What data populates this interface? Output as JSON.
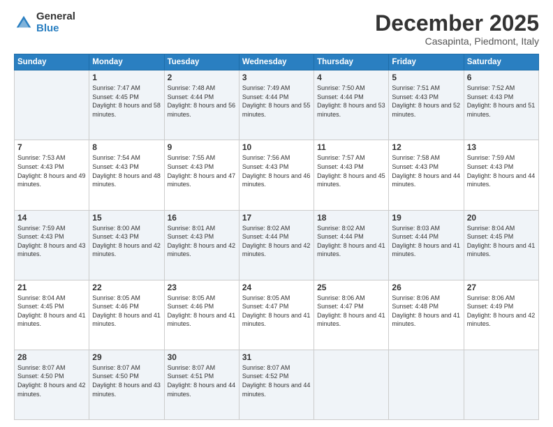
{
  "logo": {
    "general": "General",
    "blue": "Blue"
  },
  "header": {
    "month": "December 2025",
    "location": "Casapinta, Piedmont, Italy"
  },
  "weekdays": [
    "Sunday",
    "Monday",
    "Tuesday",
    "Wednesday",
    "Thursday",
    "Friday",
    "Saturday"
  ],
  "weeks": [
    [
      {
        "day": "",
        "sunrise": "",
        "sunset": "",
        "daylight": ""
      },
      {
        "day": "1",
        "sunrise": "Sunrise: 7:47 AM",
        "sunset": "Sunset: 4:45 PM",
        "daylight": "Daylight: 8 hours and 58 minutes."
      },
      {
        "day": "2",
        "sunrise": "Sunrise: 7:48 AM",
        "sunset": "Sunset: 4:44 PM",
        "daylight": "Daylight: 8 hours and 56 minutes."
      },
      {
        "day": "3",
        "sunrise": "Sunrise: 7:49 AM",
        "sunset": "Sunset: 4:44 PM",
        "daylight": "Daylight: 8 hours and 55 minutes."
      },
      {
        "day": "4",
        "sunrise": "Sunrise: 7:50 AM",
        "sunset": "Sunset: 4:44 PM",
        "daylight": "Daylight: 8 hours and 53 minutes."
      },
      {
        "day": "5",
        "sunrise": "Sunrise: 7:51 AM",
        "sunset": "Sunset: 4:43 PM",
        "daylight": "Daylight: 8 hours and 52 minutes."
      },
      {
        "day": "6",
        "sunrise": "Sunrise: 7:52 AM",
        "sunset": "Sunset: 4:43 PM",
        "daylight": "Daylight: 8 hours and 51 minutes."
      }
    ],
    [
      {
        "day": "7",
        "sunrise": "Sunrise: 7:53 AM",
        "sunset": "Sunset: 4:43 PM",
        "daylight": "Daylight: 8 hours and 49 minutes."
      },
      {
        "day": "8",
        "sunrise": "Sunrise: 7:54 AM",
        "sunset": "Sunset: 4:43 PM",
        "daylight": "Daylight: 8 hours and 48 minutes."
      },
      {
        "day": "9",
        "sunrise": "Sunrise: 7:55 AM",
        "sunset": "Sunset: 4:43 PM",
        "daylight": "Daylight: 8 hours and 47 minutes."
      },
      {
        "day": "10",
        "sunrise": "Sunrise: 7:56 AM",
        "sunset": "Sunset: 4:43 PM",
        "daylight": "Daylight: 8 hours and 46 minutes."
      },
      {
        "day": "11",
        "sunrise": "Sunrise: 7:57 AM",
        "sunset": "Sunset: 4:43 PM",
        "daylight": "Daylight: 8 hours and 45 minutes."
      },
      {
        "day": "12",
        "sunrise": "Sunrise: 7:58 AM",
        "sunset": "Sunset: 4:43 PM",
        "daylight": "Daylight: 8 hours and 44 minutes."
      },
      {
        "day": "13",
        "sunrise": "Sunrise: 7:59 AM",
        "sunset": "Sunset: 4:43 PM",
        "daylight": "Daylight: 8 hours and 44 minutes."
      }
    ],
    [
      {
        "day": "14",
        "sunrise": "Sunrise: 7:59 AM",
        "sunset": "Sunset: 4:43 PM",
        "daylight": "Daylight: 8 hours and 43 minutes."
      },
      {
        "day": "15",
        "sunrise": "Sunrise: 8:00 AM",
        "sunset": "Sunset: 4:43 PM",
        "daylight": "Daylight: 8 hours and 42 minutes."
      },
      {
        "day": "16",
        "sunrise": "Sunrise: 8:01 AM",
        "sunset": "Sunset: 4:43 PM",
        "daylight": "Daylight: 8 hours and 42 minutes."
      },
      {
        "day": "17",
        "sunrise": "Sunrise: 8:02 AM",
        "sunset": "Sunset: 4:44 PM",
        "daylight": "Daylight: 8 hours and 42 minutes."
      },
      {
        "day": "18",
        "sunrise": "Sunrise: 8:02 AM",
        "sunset": "Sunset: 4:44 PM",
        "daylight": "Daylight: 8 hours and 41 minutes."
      },
      {
        "day": "19",
        "sunrise": "Sunrise: 8:03 AM",
        "sunset": "Sunset: 4:44 PM",
        "daylight": "Daylight: 8 hours and 41 minutes."
      },
      {
        "day": "20",
        "sunrise": "Sunrise: 8:04 AM",
        "sunset": "Sunset: 4:45 PM",
        "daylight": "Daylight: 8 hours and 41 minutes."
      }
    ],
    [
      {
        "day": "21",
        "sunrise": "Sunrise: 8:04 AM",
        "sunset": "Sunset: 4:45 PM",
        "daylight": "Daylight: 8 hours and 41 minutes."
      },
      {
        "day": "22",
        "sunrise": "Sunrise: 8:05 AM",
        "sunset": "Sunset: 4:46 PM",
        "daylight": "Daylight: 8 hours and 41 minutes."
      },
      {
        "day": "23",
        "sunrise": "Sunrise: 8:05 AM",
        "sunset": "Sunset: 4:46 PM",
        "daylight": "Daylight: 8 hours and 41 minutes."
      },
      {
        "day": "24",
        "sunrise": "Sunrise: 8:05 AM",
        "sunset": "Sunset: 4:47 PM",
        "daylight": "Daylight: 8 hours and 41 minutes."
      },
      {
        "day": "25",
        "sunrise": "Sunrise: 8:06 AM",
        "sunset": "Sunset: 4:47 PM",
        "daylight": "Daylight: 8 hours and 41 minutes."
      },
      {
        "day": "26",
        "sunrise": "Sunrise: 8:06 AM",
        "sunset": "Sunset: 4:48 PM",
        "daylight": "Daylight: 8 hours and 41 minutes."
      },
      {
        "day": "27",
        "sunrise": "Sunrise: 8:06 AM",
        "sunset": "Sunset: 4:49 PM",
        "daylight": "Daylight: 8 hours and 42 minutes."
      }
    ],
    [
      {
        "day": "28",
        "sunrise": "Sunrise: 8:07 AM",
        "sunset": "Sunset: 4:50 PM",
        "daylight": "Daylight: 8 hours and 42 minutes."
      },
      {
        "day": "29",
        "sunrise": "Sunrise: 8:07 AM",
        "sunset": "Sunset: 4:50 PM",
        "daylight": "Daylight: 8 hours and 43 minutes."
      },
      {
        "day": "30",
        "sunrise": "Sunrise: 8:07 AM",
        "sunset": "Sunset: 4:51 PM",
        "daylight": "Daylight: 8 hours and 44 minutes."
      },
      {
        "day": "31",
        "sunrise": "Sunrise: 8:07 AM",
        "sunset": "Sunset: 4:52 PM",
        "daylight": "Daylight: 8 hours and 44 minutes."
      },
      {
        "day": "",
        "sunrise": "",
        "sunset": "",
        "daylight": ""
      },
      {
        "day": "",
        "sunrise": "",
        "sunset": "",
        "daylight": ""
      },
      {
        "day": "",
        "sunrise": "",
        "sunset": "",
        "daylight": ""
      }
    ]
  ]
}
